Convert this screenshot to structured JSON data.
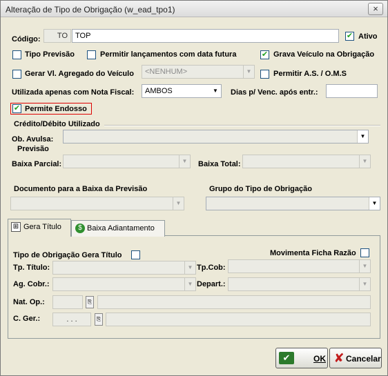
{
  "window": {
    "title": "Alteração de Tipo de Obrigação (w_ead_tpo1)",
    "close_icon": "×"
  },
  "codigo": {
    "label": "Código:",
    "prefix": "TO",
    "value": "TOP"
  },
  "ativo": {
    "label": "Ativo",
    "checked": true
  },
  "checkboxes": {
    "tipo_previsao": "Tipo Previsão",
    "permitir_lancamentos": "Permitir lançamentos com data futura",
    "grava_veiculo": "Grava Veículo na Obrigação",
    "gerar_vl_agregado": "Gerar Vl. Agregado do Veículo",
    "permitir_as": "Permitir A.S. / O.M.S",
    "permite_endosso": "Permite Endosso"
  },
  "agregado_combo": {
    "value": "<NENHUM>"
  },
  "nota_fiscal": {
    "label": "Utilizada apenas com Nota Fiscal:",
    "value": "AMBOS"
  },
  "dias_venc": {
    "label": "Dias p/ Venc. após entr.:",
    "value": ""
  },
  "credito_debito": {
    "section_title": "Crédito/Débito Utilizado"
  },
  "ob_avulsa": {
    "label": "Ob. Avulsa:"
  },
  "previsao": {
    "label": "Previsão"
  },
  "baixa_parcial": {
    "label": "Baixa Parcial:"
  },
  "baixa_total": {
    "label": "Baixa Total:"
  },
  "documento_baixa": {
    "label": "Documento para a Baixa da Previsão"
  },
  "grupo_tipo": {
    "label": "Grupo do Tipo de Obrigação"
  },
  "tabs": {
    "gera_titulo": "Gera Título",
    "baixa_adiantamento": "Baixa Adiantamento"
  },
  "gera_titulo": {
    "tipo_gera_titulo": "Tipo de Obrigação Gera Título",
    "movimenta_ficha": "Movimenta Ficha Razão",
    "tp_titulo": "Tp. Título:",
    "tp_cob": "Tp.Cob:",
    "ag_cobr": "Ag. Cobr.:",
    "depart": "Depart.:",
    "nat_op": "Nat. Op.:",
    "c_ger": "C. Ger.:",
    "c_ger_value": ". . ."
  },
  "buttons": {
    "ok": "OK",
    "cancelar": "Cancelar"
  }
}
